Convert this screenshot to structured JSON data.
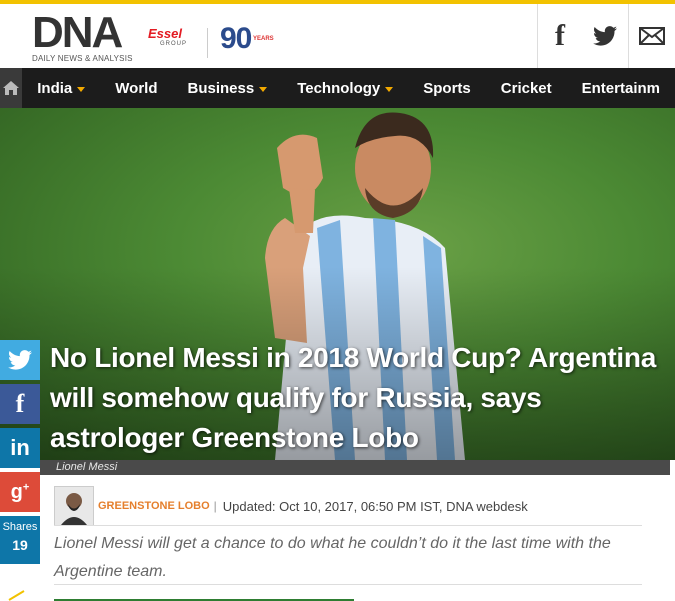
{
  "header": {
    "logo_text": "DNA",
    "logo_tagline": "DAILY NEWS & ANALYSIS",
    "partner_name": "Essel",
    "partner_group": "GROUP",
    "anniversary_number": "90",
    "anniversary_label": "YEARS",
    "social": [
      "facebook-icon",
      "twitter-icon",
      "mail-icon"
    ]
  },
  "nav": {
    "items": [
      {
        "label": "India",
        "dropdown": true
      },
      {
        "label": "World",
        "dropdown": false
      },
      {
        "label": "Business",
        "dropdown": true
      },
      {
        "label": "Technology",
        "dropdown": true
      },
      {
        "label": "Sports",
        "dropdown": false
      },
      {
        "label": "Cricket",
        "dropdown": false
      },
      {
        "label": "Entertainm",
        "dropdown": false
      }
    ]
  },
  "article": {
    "headline": "No Lionel Messi in 2018 World Cup? Argentina will somehow qualify for Russia, says astrologer Greenstone Lobo",
    "image_caption": "Lionel Messi",
    "author": "GREENSTONE LOBO",
    "updated": "Updated: Oct 10, 2017, 06:50 PM IST, DNA webdesk",
    "summary": "Lionel Messi will get a chance to do what he couldn’t do it the last time with the Argentine team."
  },
  "share": {
    "label": "Shares",
    "count": "19"
  },
  "colors": {
    "accent_bar": "#f2c200",
    "nav_bg": "#1c1c1c",
    "caret": "#f2a900",
    "author": "#e57f2c",
    "twitter": "#41abe1",
    "facebook": "#3b5998",
    "linkedin": "#0e76a8",
    "googleplus": "#dd4b39"
  }
}
